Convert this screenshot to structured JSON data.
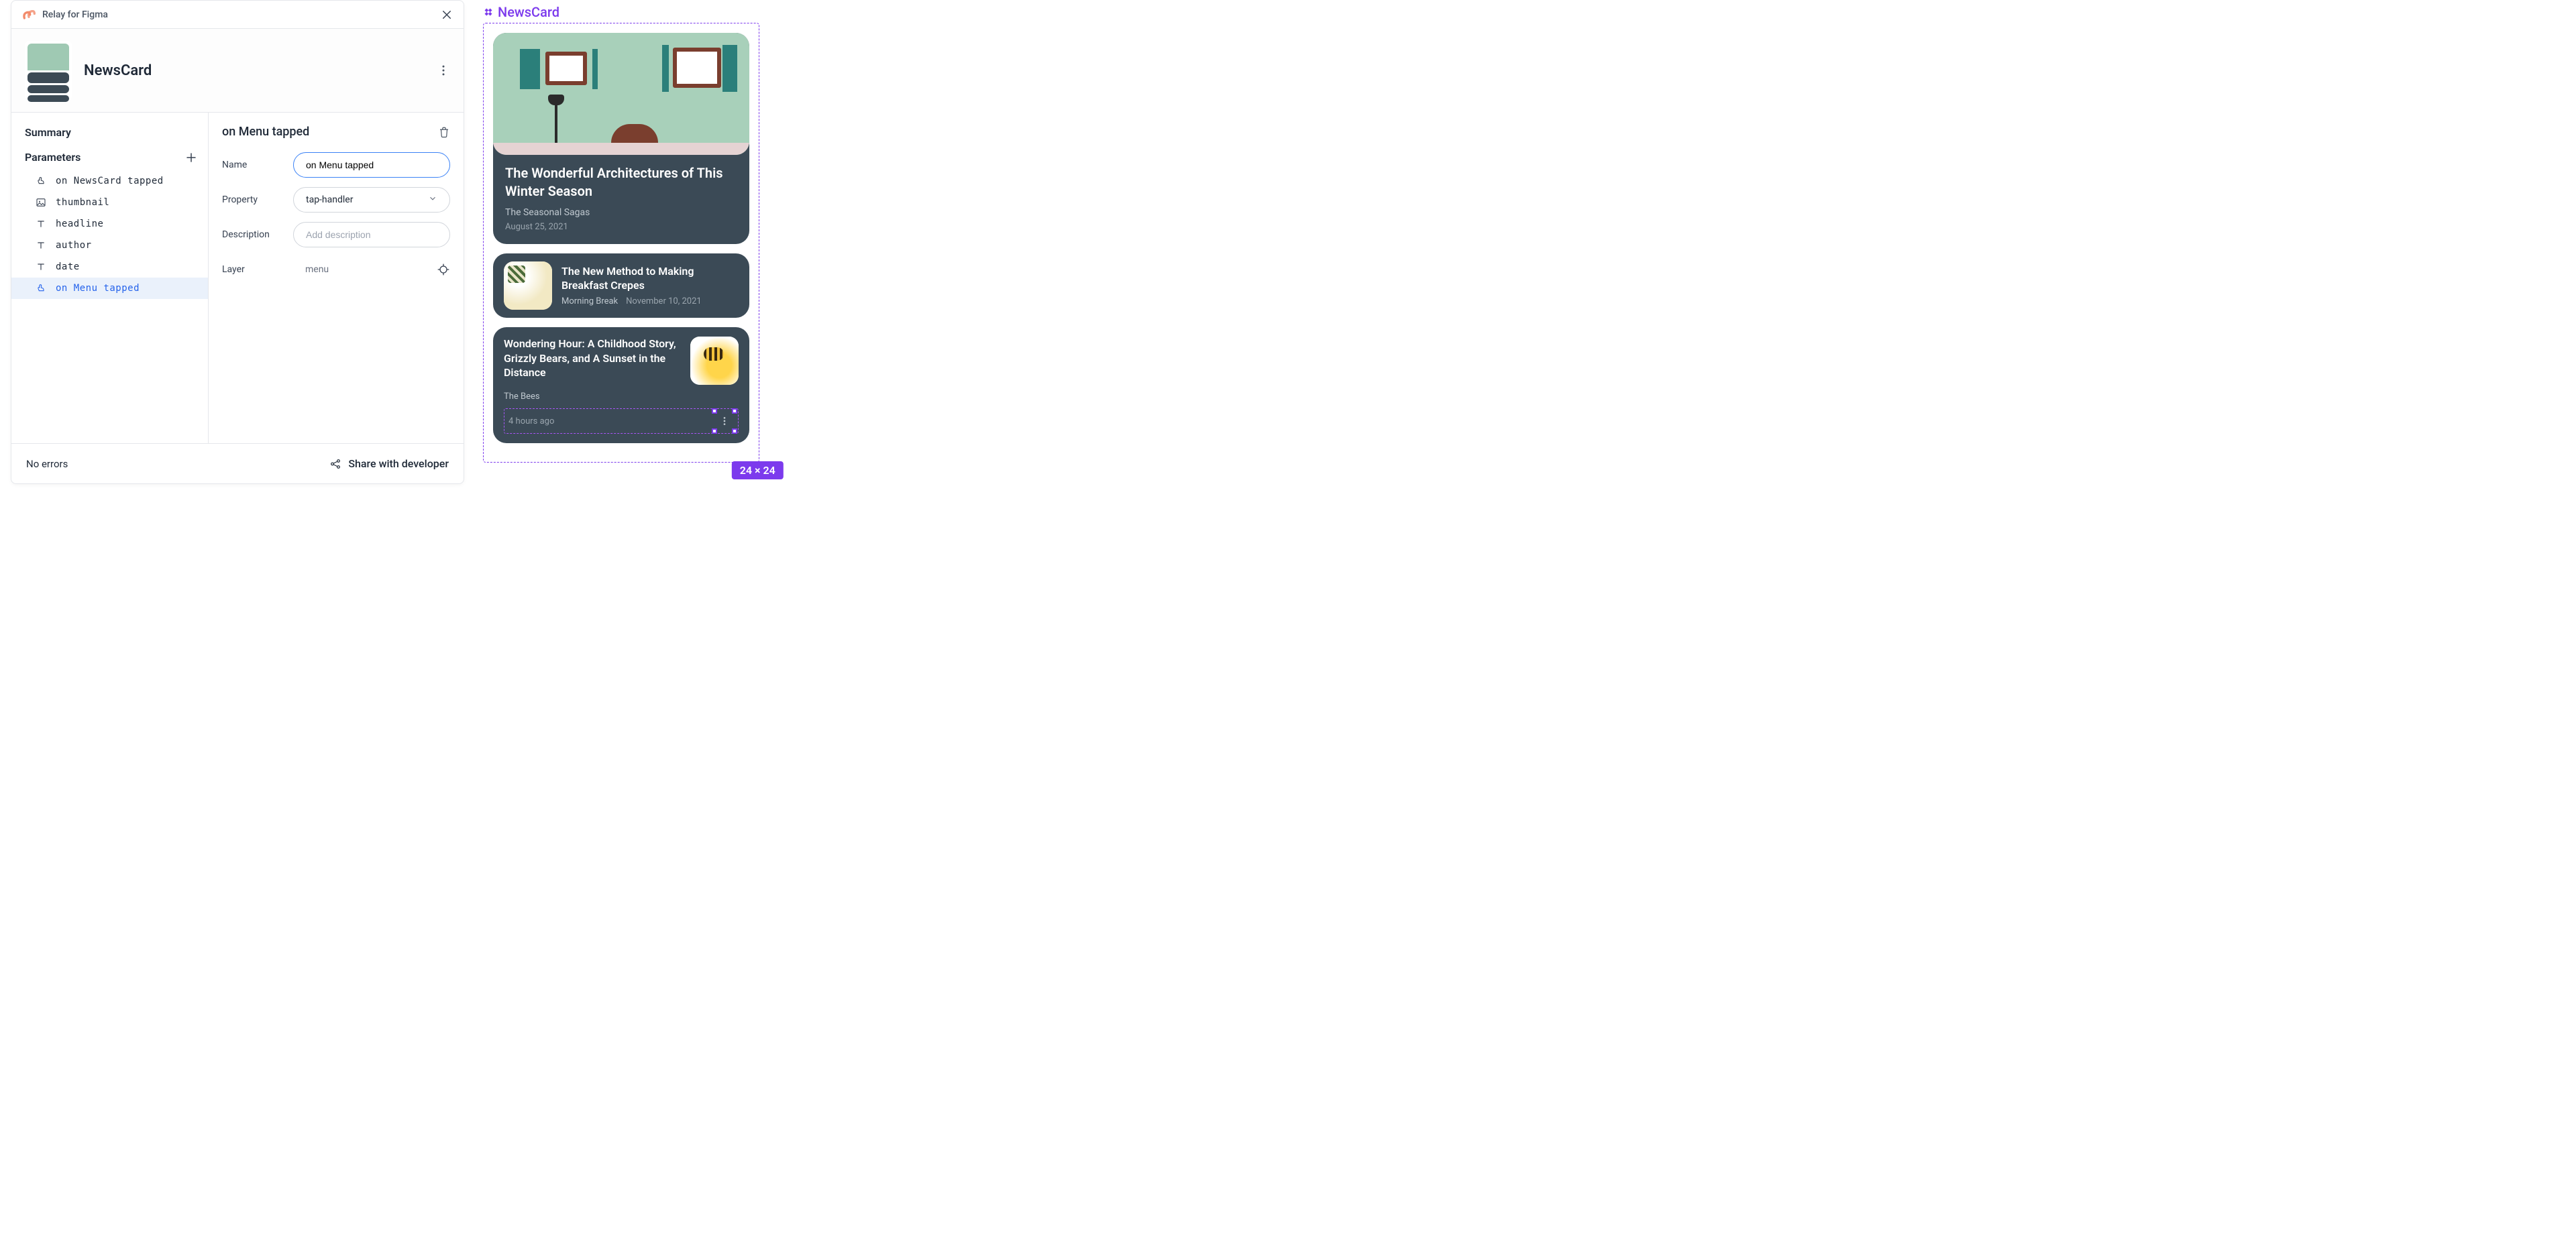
{
  "plugin": {
    "title": "Relay for Figma",
    "component_name": "NewsCard"
  },
  "sidebar": {
    "summary_label": "Summary",
    "parameters_label": "Parameters",
    "items": [
      {
        "icon": "tap",
        "label": "on NewsCard tapped"
      },
      {
        "icon": "image",
        "label": "thumbnail"
      },
      {
        "icon": "text",
        "label": "headline"
      },
      {
        "icon": "text",
        "label": "author"
      },
      {
        "icon": "text",
        "label": "date"
      },
      {
        "icon": "tap",
        "label": "on Menu tapped"
      }
    ]
  },
  "detail": {
    "title": "on Menu tapped",
    "fields": {
      "name_label": "Name",
      "name_value": "on Menu tapped",
      "property_label": "Property",
      "property_value": "tap-handler",
      "description_label": "Description",
      "description_placeholder": "Add description",
      "layer_label": "Layer",
      "layer_value": "menu"
    }
  },
  "footer": {
    "status": "No errors",
    "share_label": "Share with developer"
  },
  "preview": {
    "component_label": "NewsCard",
    "selection_size": "24 × 24",
    "cards": [
      {
        "title": "The Wonderful Architectures of This Winter Season",
        "author": "The Seasonal Sagas",
        "date": "August 25, 2021"
      },
      {
        "title": "The New Method to Making Breakfast Crepes",
        "author": "Morning Break",
        "date": "November 10, 2021"
      },
      {
        "title": "Wondering Hour: A Childhood Story, Grizzly Bears, and A Sunset in the Distance",
        "author": "The Bees",
        "date": "4 hours ago"
      }
    ]
  }
}
